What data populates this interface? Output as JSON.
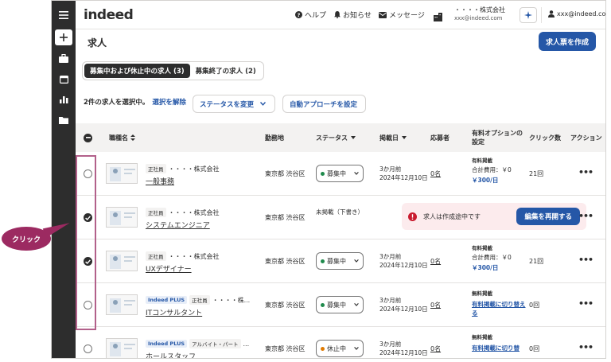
{
  "header": {
    "logo": "indeed",
    "help": "ヘルプ",
    "notifications": "お知らせ",
    "messages": "メッセージ",
    "company_name": "・・・・株式会社",
    "company_email": "xxx@indeed.com",
    "user_email": "xxx@indeed.co..."
  },
  "page": {
    "title": "求人",
    "create_button": "求人票を作成",
    "tabs": [
      {
        "label": "募集中および休止中の求人 (3)",
        "active": true
      },
      {
        "label": "募集終了の求人 (2)",
        "active": false
      }
    ],
    "selection_text": "2件の求人を選択中。",
    "deselect_link": "選択を解除",
    "change_status_button": "ステータスを変更",
    "auto_approach_button": "自動アプローチを設定"
  },
  "table": {
    "columns": {
      "title": "職種名",
      "location": "勤務地",
      "status": "ステータス",
      "posted": "掲載日",
      "applicants": "応募者",
      "options": "有料オプションの設定",
      "clicks": "クリック数",
      "action": "アクション"
    },
    "rows": [
      {
        "checked": false,
        "tags": [
          "正社員"
        ],
        "company": "・・・・株式会社",
        "title": "一般事務",
        "location": "東京都 渋谷区",
        "status": "募集中",
        "posted_ago": "3か月前",
        "posted_date": "2024年12月10日",
        "applicants": "0名",
        "opt_title": "有料掲載",
        "opt_line": "合計費用：￥0",
        "opt_link": "￥300/日",
        "clicks": "21回"
      },
      {
        "checked": true,
        "tags": [
          "正社員"
        ],
        "company": "・・・・株式会社",
        "title": "システムエンジニア",
        "location": "東京都 渋谷区",
        "status_text": "未掲載（下書き）",
        "banner_text": "求人は作成途中です",
        "banner_button": "編集を再開する"
      },
      {
        "checked": true,
        "tags": [
          "正社員"
        ],
        "company": "・・・・株式会社",
        "title": "UXデザイナー",
        "location": "東京都 渋谷区",
        "status": "募集中",
        "posted_ago": "3か月前",
        "posted_date": "2024年12月10日",
        "applicants": "0名",
        "opt_title": "有料掲載",
        "opt_line": "合計費用：￥0",
        "opt_link": "￥300/日",
        "clicks": "21回"
      },
      {
        "checked": false,
        "tags": [
          "Indeed PLUS",
          "正社員"
        ],
        "company": "・・・・株...",
        "title": "ITコンサルタント",
        "location": "東京都 渋谷区",
        "status": "募集中",
        "posted_ago": "3か月前",
        "posted_date": "2024年12月10日",
        "applicants": "0名",
        "opt_title": "無料掲載",
        "opt_link": "有料掲載に切り替える",
        "clicks": "0回"
      },
      {
        "checked": false,
        "tags": [
          "Indeed PLUS",
          "アルバイト・パート"
        ],
        "company": "...",
        "title": "ホールスタッフ",
        "location": "東京都 渋谷区",
        "status": "休止中",
        "posted_ago": "3か月前",
        "posted_date": "2024年12月10日",
        "applicants": "0名",
        "opt_title": "無料掲載",
        "opt_link": "有料掲載に切り替",
        "clicks": "0回"
      }
    ]
  },
  "annotation": {
    "callout": "クリック"
  }
}
